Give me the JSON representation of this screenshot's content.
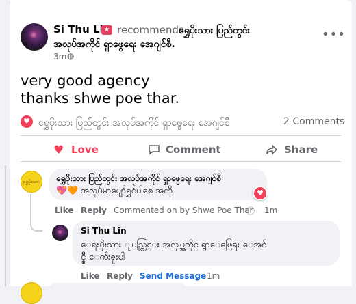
{
  "post": {
    "author": "Si Thu Lin",
    "recommends_text": "recommends",
    "page_name_line1": "ရွှေပိုးသား ပြည်တွင်း",
    "page_name_line2": "အလုပ်အကိုင် ရှာဖွေရေး အေဂျင်စီ.",
    "time": "3m",
    "body_line1": "very good agency",
    "body_line2": "thanks shwe poe thar.",
    "reaction_page_name": "ရွှေပိုးသား ပြည်တွင်း အလုပ်အကိုင် ရှာဖွေရေး အေဂျင်စီ",
    "comments_count": "2 Comments",
    "more_icon": "more-horizontal-icon",
    "globe_icon": "globe-icon"
  },
  "actions": {
    "love": "Love",
    "comment": "Comment",
    "share": "Share",
    "love_color": "#f33e58"
  },
  "comments": [
    {
      "author": "ရွှေပိုးသား ပြည်တွင်း အလုပ်အကိုင် ရှာဖွေရေး အေဂျင်စီ",
      "text": "အလုပ်မှာပျော်ရွှင်ပါစေ အကို",
      "emoji": "💖🧡",
      "like": "Like",
      "reply": "Reply",
      "commented_on_by": "Commented on by Shwe Poe Thar",
      "time": "1m",
      "logo_text": "ရွှေပိုးသား"
    },
    {
      "author": "Si Thu Lin",
      "text_line1": "ေရႊပိုးသား ျပည္တြင္း အလုပ္အကိုင္ ရွာေဖြေရး ေအဂ်",
      "text_line2": "င္စီ ေက်းဇူးပါ",
      "like": "Like",
      "reply": "Reply",
      "send_message": "Send Message",
      "time": "1m"
    }
  ]
}
